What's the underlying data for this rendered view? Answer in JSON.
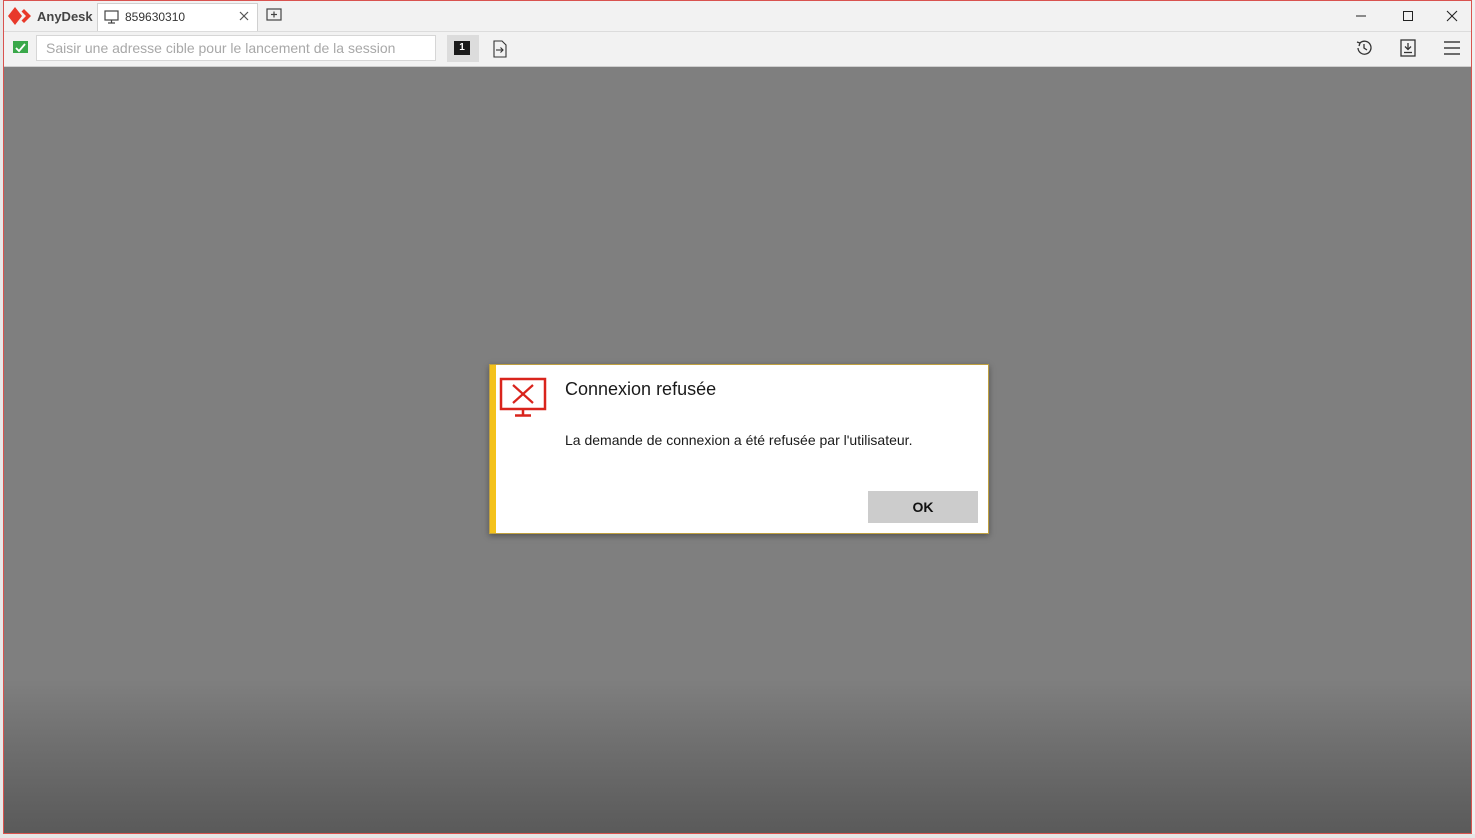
{
  "app": {
    "name": "AnyDesk",
    "brand_color": "#e8392a"
  },
  "tab": {
    "label": "859630310",
    "icon": "monitor-icon"
  },
  "toolbar": {
    "address_placeholder": "Saisir une adresse cible pour le lancement de la session",
    "address_value": "",
    "session_badge": "1",
    "icons": [
      "connection-status-icon",
      "file-transfer-icon",
      "history-icon",
      "install-icon",
      "menu-icon"
    ]
  },
  "window_controls": [
    "minimize-icon",
    "maximize-icon",
    "close-icon"
  ],
  "dialog": {
    "title": "Connexion refusée",
    "message": "La demande de connexion a été refusée par l'utilisateur.",
    "ok_label": "OK",
    "icon": "monitor-error-icon",
    "accent_color": "#f4c21b",
    "icon_color": "#d9241c"
  }
}
